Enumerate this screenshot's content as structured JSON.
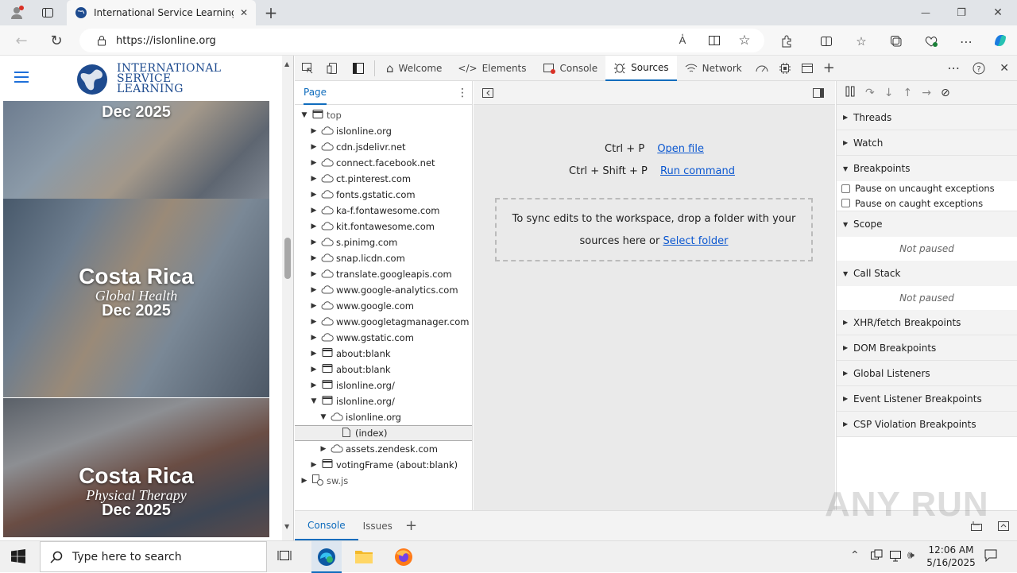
{
  "browser": {
    "tab_title": "International Service Learning",
    "url": "https://islonline.org",
    "window_min": "—",
    "window_max": "❐",
    "window_close": "✕"
  },
  "page": {
    "logo_line1": "INTERNATIONAL",
    "logo_line2": "SERVICE",
    "logo_line3": "LEARNING",
    "cards": [
      {
        "title": "",
        "subtitle": "",
        "date": "Dec 2025"
      },
      {
        "title": "Costa Rica",
        "subtitle": "Global Health",
        "date": "Dec 2025"
      },
      {
        "title": "Costa Rica",
        "subtitle": "Physical Therapy",
        "date": "Dec 2025"
      }
    ]
  },
  "devtools": {
    "tabs": [
      "Welcome",
      "Elements",
      "Console",
      "Sources",
      "Network"
    ],
    "active_tab": "Sources",
    "navigator_tab": "Page",
    "tree": [
      {
        "depth": 0,
        "arrow": "▼",
        "icon": "frame",
        "label": "top"
      },
      {
        "depth": 1,
        "arrow": "▶",
        "icon": "cloud",
        "label": "islonline.org"
      },
      {
        "depth": 1,
        "arrow": "▶",
        "icon": "cloud",
        "label": "cdn.jsdelivr.net"
      },
      {
        "depth": 1,
        "arrow": "▶",
        "icon": "cloud",
        "label": "connect.facebook.net"
      },
      {
        "depth": 1,
        "arrow": "▶",
        "icon": "cloud",
        "label": "ct.pinterest.com"
      },
      {
        "depth": 1,
        "arrow": "▶",
        "icon": "cloud",
        "label": "fonts.gstatic.com"
      },
      {
        "depth": 1,
        "arrow": "▶",
        "icon": "cloud",
        "label": "ka-f.fontawesome.com"
      },
      {
        "depth": 1,
        "arrow": "▶",
        "icon": "cloud",
        "label": "kit.fontawesome.com"
      },
      {
        "depth": 1,
        "arrow": "▶",
        "icon": "cloud",
        "label": "s.pinimg.com"
      },
      {
        "depth": 1,
        "arrow": "▶",
        "icon": "cloud",
        "label": "snap.licdn.com"
      },
      {
        "depth": 1,
        "arrow": "▶",
        "icon": "cloud",
        "label": "translate.googleapis.com"
      },
      {
        "depth": 1,
        "arrow": "▶",
        "icon": "cloud",
        "label": "www.google-analytics.com"
      },
      {
        "depth": 1,
        "arrow": "▶",
        "icon": "cloud",
        "label": "www.google.com"
      },
      {
        "depth": 1,
        "arrow": "▶",
        "icon": "cloud",
        "label": "www.googletagmanager.com"
      },
      {
        "depth": 1,
        "arrow": "▶",
        "icon": "cloud",
        "label": "www.gstatic.com"
      },
      {
        "depth": 1,
        "arrow": "▶",
        "icon": "frame",
        "label": "about:blank"
      },
      {
        "depth": 1,
        "arrow": "▶",
        "icon": "frame",
        "label": "about:blank"
      },
      {
        "depth": 1,
        "arrow": "▶",
        "icon": "frame",
        "label": "islonline.org/"
      },
      {
        "depth": 1,
        "arrow": "▼",
        "icon": "frame",
        "label": "islonline.org/"
      },
      {
        "depth": 2,
        "arrow": "▼",
        "icon": "cloud",
        "label": "islonline.org"
      },
      {
        "depth": 3,
        "arrow": "",
        "icon": "file",
        "label": "(index)",
        "selected": true
      },
      {
        "depth": 2,
        "arrow": "▶",
        "icon": "cloud",
        "label": "assets.zendesk.com"
      },
      {
        "depth": 1,
        "arrow": "▶",
        "icon": "frame",
        "label": "votingFrame (about:blank)"
      },
      {
        "depth": 0,
        "arrow": "▶",
        "icon": "gear",
        "label": "sw.js"
      }
    ],
    "editor": {
      "shortcut1_keys": "Ctrl + P",
      "shortcut1_link": "Open file",
      "shortcut2_keys": "Ctrl + Shift + P",
      "shortcut2_link": "Run command",
      "drop_text1": "To sync edits to the workspace, drop a folder with your",
      "drop_text2": "sources here or",
      "drop_link": "Select folder"
    },
    "debugger": {
      "threads": "Threads",
      "watch": "Watch",
      "breakpoints": "Breakpoints",
      "pause_uncaught": "Pause on uncaught exceptions",
      "pause_caught": "Pause on caught exceptions",
      "scope": "Scope",
      "scope_state": "Not paused",
      "call_stack": "Call Stack",
      "call_stack_state": "Not paused",
      "xhr": "XHR/fetch Breakpoints",
      "dom": "DOM Breakpoints",
      "global": "Global Listeners",
      "event": "Event Listener Breakpoints",
      "csp": "CSP Violation Breakpoints"
    },
    "drawer_tabs": [
      "Console",
      "Issues"
    ]
  },
  "taskbar": {
    "search_placeholder": "Type here to search",
    "time": "12:06 AM",
    "date": "5/16/2025"
  },
  "watermark": "ANY RUN"
}
